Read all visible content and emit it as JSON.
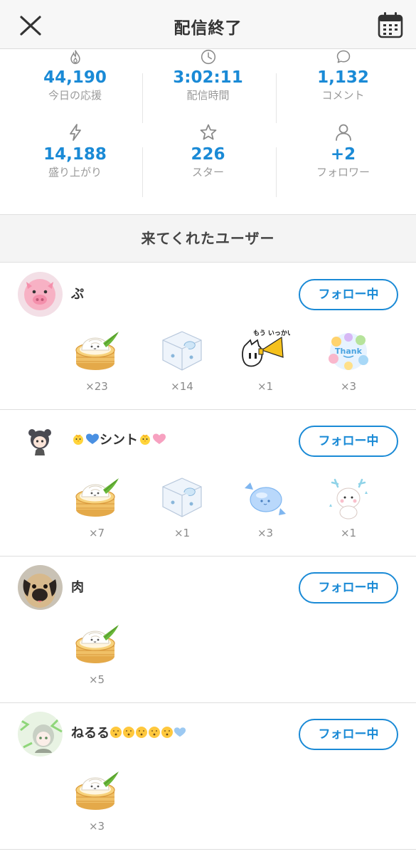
{
  "header": {
    "title": "配信終了",
    "close_icon": "close-icon",
    "calendar_icon": "calendar-icon"
  },
  "stats": [
    {
      "icon": "fire-icon",
      "value": "44,190",
      "label": "今日の応援"
    },
    {
      "icon": "clock-icon",
      "value": "3:02:11",
      "label": "配信時間"
    },
    {
      "icon": "comment-icon",
      "value": "1,132",
      "label": "コメント"
    },
    {
      "icon": "bolt-icon",
      "value": "14,188",
      "label": "盛り上がり"
    },
    {
      "icon": "star-icon",
      "value": "226",
      "label": "スター"
    },
    {
      "icon": "person-icon",
      "value": "+2",
      "label": "フォロワー"
    }
  ],
  "visitors_section": {
    "title": "来てくれたユーザー"
  },
  "users": [
    {
      "name": "ぷ",
      "follow_label": "フォロー中",
      "gifts": [
        {
          "icon": "dumpling-steamer-icon",
          "count": "×23"
        },
        {
          "icon": "dice-icon",
          "count": "×14"
        },
        {
          "icon": "cat-megaphone-icon",
          "count": "×1",
          "caption": "もう いっかい"
        },
        {
          "icon": "thank-you-sticker-icon",
          "count": "×3"
        }
      ]
    },
    {
      "name": "シント",
      "follow_label": "フォロー中",
      "gifts": [
        {
          "icon": "dumpling-steamer-icon",
          "count": "×7"
        },
        {
          "icon": "dice-icon",
          "count": "×1"
        },
        {
          "icon": "blue-candy-icon",
          "count": "×3"
        },
        {
          "icon": "reindeer-icon",
          "count": "×1"
        }
      ]
    },
    {
      "name": "肉",
      "follow_label": "フォロー中",
      "gifts": [
        {
          "icon": "dumpling-steamer-icon",
          "count": "×5"
        }
      ]
    },
    {
      "name": "ねるる",
      "follow_label": "フォロー中",
      "gifts": [
        {
          "icon": "dumpling-steamer-icon",
          "count": "×3"
        }
      ]
    }
  ],
  "colors": {
    "accent": "#1a8ad6",
    "label_gray": "#9a9a9a",
    "nav_bg": "#f7f7f7"
  }
}
